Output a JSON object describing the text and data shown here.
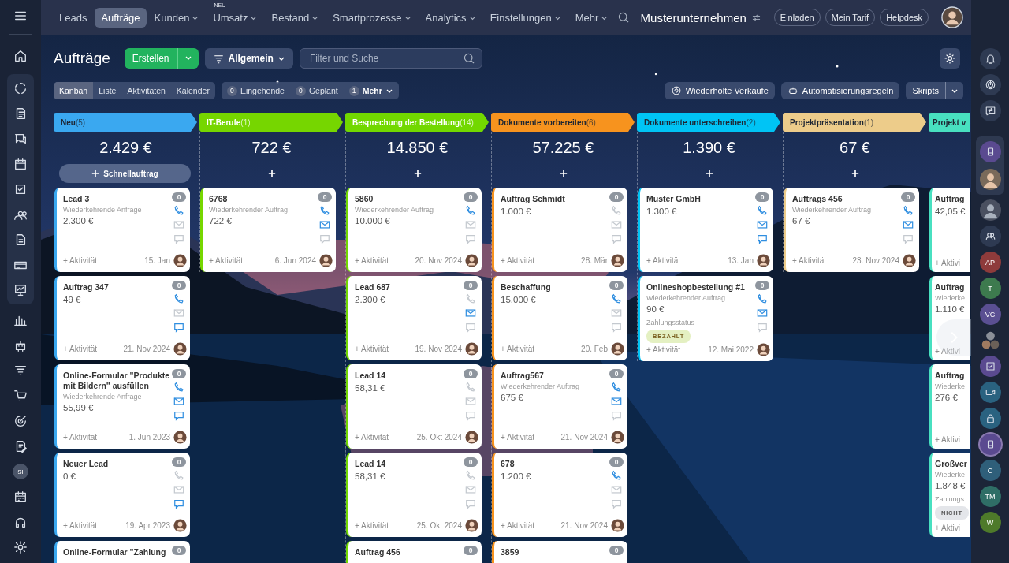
{
  "top_nav": {
    "items": [
      {
        "label": "Leads",
        "selected": false,
        "dropdown": false
      },
      {
        "label": "Aufträge",
        "selected": true,
        "dropdown": false
      },
      {
        "label": "Kunden",
        "selected": false,
        "dropdown": true
      },
      {
        "label": "Umsatz",
        "selected": false,
        "dropdown": true,
        "badge": "NEU"
      },
      {
        "label": "Bestand",
        "selected": false,
        "dropdown": true
      },
      {
        "label": "Smartprozesse",
        "selected": false,
        "dropdown": true
      },
      {
        "label": "Analytics",
        "selected": false,
        "dropdown": true
      },
      {
        "label": "Einstellungen",
        "selected": false,
        "dropdown": true
      },
      {
        "label": "Mehr",
        "selected": false,
        "dropdown": true
      }
    ],
    "company": "Musterunternehmen",
    "buttons": [
      "Einladen",
      "Mein Tarif",
      "Helpdesk"
    ]
  },
  "left_rail": {
    "user_initials": "SI"
  },
  "toolbar": {
    "title": "Aufträge",
    "create_button": "Erstellen",
    "filter_preset": "Allgemein",
    "search": {
      "placeholder": "Filter und Suche"
    }
  },
  "views": [
    {
      "label": "Kanban",
      "selected": true
    },
    {
      "label": "Liste",
      "selected": false
    },
    {
      "label": "Aktivitäten",
      "selected": false
    },
    {
      "label": "Kalender",
      "selected": false
    }
  ],
  "counters": [
    {
      "count": "0",
      "label": "Eingehende",
      "dropdown": false
    },
    {
      "count": "0",
      "label": "Geplant",
      "dropdown": false
    },
    {
      "count": "1",
      "label": "Mehr",
      "dropdown": true
    }
  ],
  "actions": [
    {
      "label": "Wiederholte Verkäufe",
      "kind": "recurring"
    },
    {
      "label": "Automatisierungsregeln",
      "kind": "robot"
    },
    {
      "label": "Skripts",
      "kind": "split"
    }
  ],
  "columns": [
    {
      "title": "Neu",
      "count": "(5)",
      "color": "#3aa8f0",
      "clipped": false,
      "total": "2.429 €",
      "add_label": "Schnellauftrag",
      "cards": [
        {
          "title": "Lead 3",
          "subtitle": "Wiederkehrende Anfrage",
          "amount": "2.300 €",
          "count": "0",
          "phone": true,
          "mail": false,
          "chat": false,
          "activity": "+ Aktivität",
          "date": "15. Jan"
        },
        {
          "title": "Auftrag 347",
          "amount": "49 €",
          "count": "0",
          "phone": true,
          "mail": false,
          "chat": true,
          "activity": "+ Aktivität",
          "date": "21. Nov 2024"
        },
        {
          "title": "Online-Formular \"Produkte mit Bildern\" ausfüllen",
          "subtitle": "Wiederkehrende Anfrage",
          "amount": "55,99 €",
          "count": "0",
          "phone": true,
          "mail": true,
          "chat": true,
          "activity": "+ Aktivität",
          "date": "1. Jun 2023"
        },
        {
          "title": "Neuer Lead",
          "amount": "0 €",
          "count": "0",
          "phone": false,
          "mail": false,
          "chat": true,
          "activity": "+ Aktivität",
          "date": "19. Apr 2023"
        },
        {
          "title": "Online-Formular \"Zahlung",
          "count": "0"
        }
      ]
    },
    {
      "title": "IT-Berufe",
      "count": "(1)",
      "color": "#76d600",
      "clipped": false,
      "total": "722 €",
      "cards": [
        {
          "title": "6768",
          "subtitle": "Wiederkehrender Auftrag",
          "amount": "722 €",
          "count": "0",
          "phone": true,
          "mail": true,
          "chat": false,
          "activity": "+ Aktivität",
          "date": "6. Jun 2024"
        }
      ]
    },
    {
      "title": "Besprechung der Bestellung",
      "count": "(14)",
      "color": "#72d800",
      "clipped": false,
      "total": "14.850 €",
      "cards": [
        {
          "title": "5860",
          "subtitle": "Wiederkehrender Auftrag",
          "amount": "10.000 €",
          "count": "0",
          "phone": true,
          "mail": false,
          "chat": false,
          "activity": "+ Aktivität",
          "date": "20. Nov 2024"
        },
        {
          "title": "Lead 687",
          "amount": "2.300 €",
          "count": "0",
          "phone": false,
          "mail": true,
          "chat": false,
          "activity": "+ Aktivität",
          "date": "19. Nov 2024"
        },
        {
          "title": "Lead 14",
          "amount": "58,31 €",
          "count": "0",
          "phone": false,
          "mail": false,
          "chat": false,
          "activity": "+ Aktivität",
          "date": "25. Okt 2024"
        },
        {
          "title": "Lead 14",
          "amount": "58,31 €",
          "count": "0",
          "phone": false,
          "mail": false,
          "chat": false,
          "activity": "+ Aktivität",
          "date": "25. Okt 2024"
        },
        {
          "title": "Auftrag 456",
          "count": "0"
        }
      ]
    },
    {
      "title": "Dokumente vorbereiten",
      "count": "(6)",
      "color": "#f7931e",
      "clipped": false,
      "total": "57.225 €",
      "cards": [
        {
          "title": "Auftrag Schmidt",
          "amount": "1.000 €",
          "count": "0",
          "phone": false,
          "mail": false,
          "chat": false,
          "activity": "+ Aktivität",
          "date": "28. Mär"
        },
        {
          "title": "Beschaffung",
          "amount": "15.000 €",
          "count": "0",
          "phone": true,
          "mail": false,
          "chat": false,
          "activity": "+ Aktivität",
          "date": "20. Feb"
        },
        {
          "title": "Auftrag567",
          "subtitle": "Wiederkehrender Auftrag",
          "amount": "675 €",
          "count": "0",
          "phone": true,
          "mail": true,
          "chat": false,
          "activity": "+ Aktivität",
          "date": "21. Nov 2024"
        },
        {
          "title": "678",
          "amount": "1.200 €",
          "count": "0",
          "phone": true,
          "mail": false,
          "chat": false,
          "activity": "+ Aktivität",
          "date": "21. Nov 2024"
        },
        {
          "title": "3859",
          "count": "0"
        }
      ]
    },
    {
      "title": "Dokumente unterschreiben",
      "count": "(2)",
      "color": "#00c4f5",
      "clipped": false,
      "total": "1.390 €",
      "cards": [
        {
          "title": "Muster GmbH",
          "amount": "1.300 €",
          "count": "0",
          "phone": true,
          "mail": true,
          "chat": true,
          "activity": "+ Aktivität",
          "date": "13. Jan"
        },
        {
          "title": "Onlineshopbestellung #1",
          "subtitle": "Wiederkehrender Auftrag",
          "amount": "90 €",
          "field_label": "Zahlungsstatus",
          "badge": {
            "label": "BEZAHLT",
            "kind": "paid"
          },
          "count": "0",
          "phone": true,
          "mail": true,
          "chat": false,
          "activity": "+ Aktivität",
          "date": "12. Mai 2022"
        }
      ]
    },
    {
      "title": "Projektpräsentation",
      "count": "(1)",
      "color": "#edcc8a",
      "clipped": false,
      "total": "67 €",
      "cards": [
        {
          "title": "Auftrags 456",
          "subtitle": "Wiederkehrender Auftrag",
          "amount": "67 €",
          "count": "0",
          "phone": true,
          "mail": true,
          "chat": false,
          "activity": "+ Aktivität",
          "date": "23. Nov 2024"
        }
      ]
    },
    {
      "title": "Projekt v",
      "color": "#48e0c0",
      "clipped": true,
      "cards": [
        {
          "title": "Auftrag",
          "amount": "42,05 €",
          "activity": "+ Aktivi"
        },
        {
          "title": "Auftrag",
          "subtitle": "Wiederke",
          "amount": "1.110 €",
          "activity": "+ Aktivi"
        },
        {
          "title": "Auftrag",
          "subtitle": "Wiederke",
          "amount": "276 €",
          "activity": "+ Aktivi"
        },
        {
          "title": "Großver",
          "subtitle": "Wiederke",
          "amount": "1.848 €",
          "field_label": "Zahlungs",
          "badge": {
            "label": "NICHT",
            "kind": "unpaid"
          },
          "activity": "+ Aktivi"
        }
      ]
    }
  ],
  "right_rail": {
    "contacts_top": [
      {
        "initials": "AP",
        "color": "#8e3b3b"
      },
      {
        "initials": "T",
        "color": "#3d7a4e"
      },
      {
        "initials": "VC",
        "color": "#5a4f92"
      }
    ],
    "contacts_bottom": [
      {
        "initials": "C",
        "color": "#2f5f7a"
      },
      {
        "initials": "TM",
        "color": "#2f6e66"
      },
      {
        "initials": "W",
        "color": "#4e7a2a"
      }
    ]
  }
}
